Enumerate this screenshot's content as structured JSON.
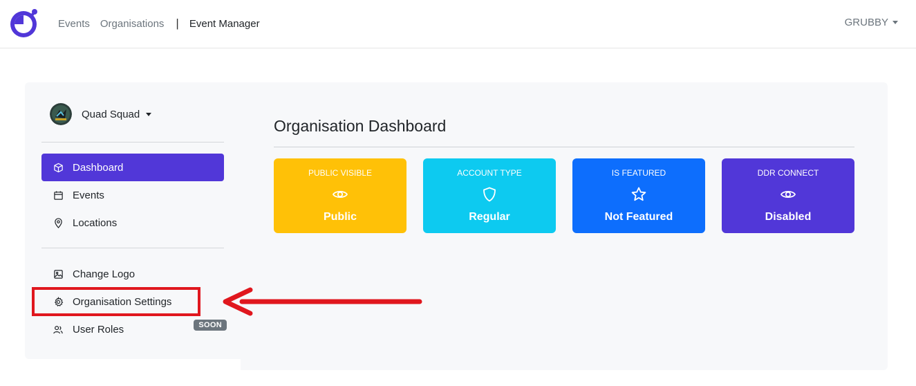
{
  "navbar": {
    "logo_icon": "stopwatch-logo-icon",
    "links": [
      "Events",
      "Organisations"
    ],
    "separator": "|",
    "brand": "Event Manager",
    "user": "GRUBBY"
  },
  "sidebar": {
    "org_name": "Quad Squad",
    "primary_items": [
      {
        "label": "Dashboard",
        "icon": "cube-icon",
        "active": true
      },
      {
        "label": "Events",
        "icon": "calendar-icon",
        "active": false
      },
      {
        "label": "Locations",
        "icon": "location-pin-icon",
        "active": false
      }
    ],
    "secondary_items": [
      {
        "label": "Change Logo",
        "icon": "image-icon"
      },
      {
        "label": "Organisation Settings",
        "icon": "gear-icon"
      },
      {
        "label": "User Roles",
        "icon": "users-icon",
        "badge": "SOON"
      }
    ]
  },
  "main": {
    "title": "Organisation Dashboard",
    "cards": [
      {
        "label": "PUBLIC VISIBLE",
        "value": "Public",
        "icon": "eye-icon",
        "color": "#ffc107"
      },
      {
        "label": "ACCOUNT TYPE",
        "value": "Regular",
        "icon": "shield-icon",
        "color": "#0dcaf0"
      },
      {
        "label": "IS FEATURED",
        "value": "Not Featured",
        "icon": "star-icon",
        "color": "#0d6efd"
      },
      {
        "label": "DDR CONNECT",
        "value": "Disabled",
        "icon": "eye-icon",
        "color": "#5137d8"
      }
    ]
  },
  "colors": {
    "accent": "#5137d8",
    "annotation": "#e0171e"
  }
}
